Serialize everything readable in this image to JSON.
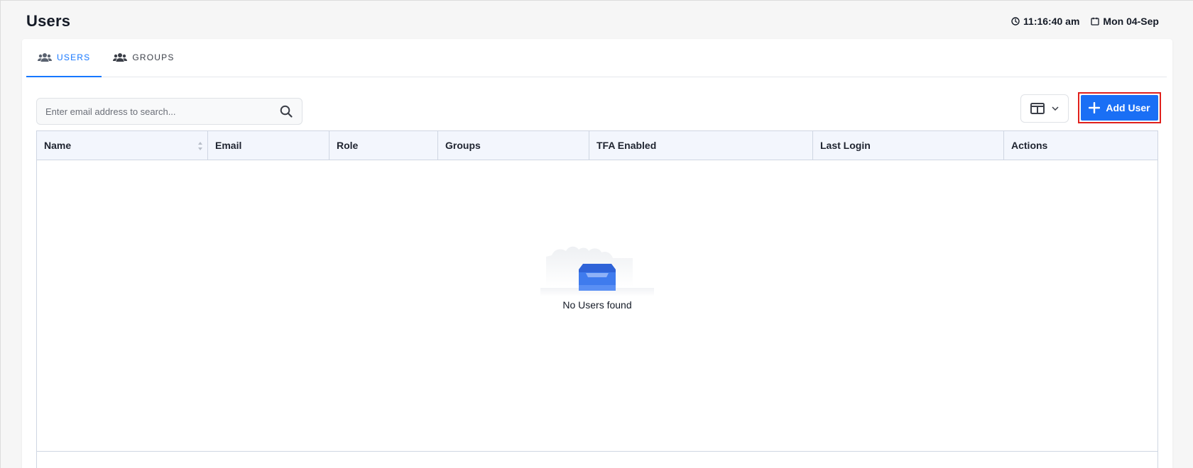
{
  "header": {
    "title": "Users",
    "time": "11:16:40 am",
    "date": "Mon 04-Sep"
  },
  "tabs": [
    {
      "label": "USERS",
      "active": true,
      "icon": "users-icon"
    },
    {
      "label": "GROUPS",
      "active": false,
      "icon": "users-icon"
    }
  ],
  "search": {
    "placeholder": "Enter email address to search...",
    "value": ""
  },
  "toolbar": {
    "add_user_label": "Add User",
    "accent_color": "#1a6ff5"
  },
  "table": {
    "columns": [
      "Name",
      "Email",
      "Role",
      "Groups",
      "TFA Enabled",
      "Last Login",
      "Actions"
    ],
    "rows": [],
    "empty_text": "No Users found"
  }
}
